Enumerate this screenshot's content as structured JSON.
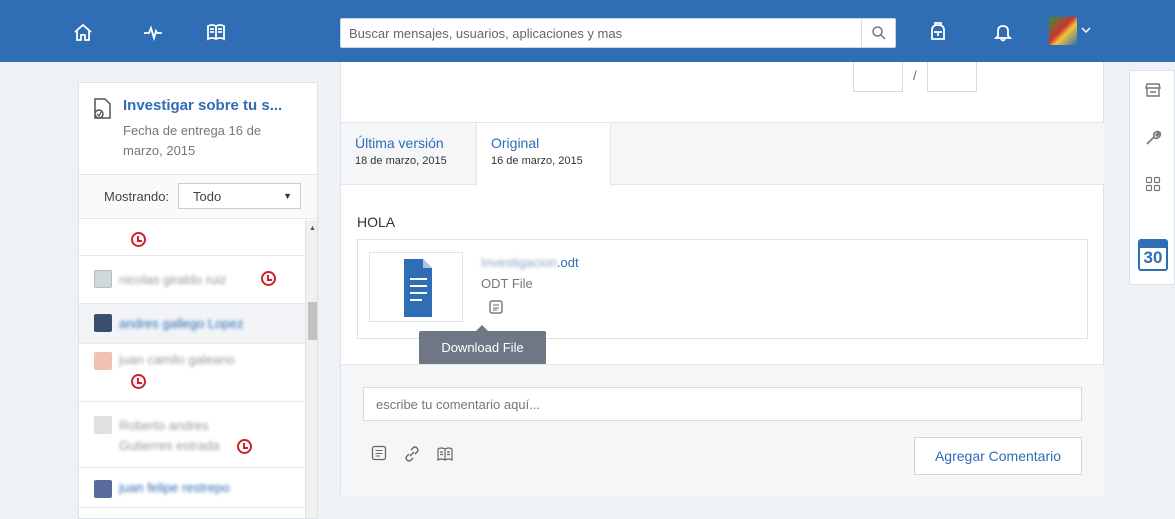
{
  "topbar": {
    "search_placeholder": "Buscar mensajes, usuarios, aplicaciones y mas",
    "icons": [
      "home-icon",
      "activity-icon",
      "book-icon",
      "search-icon",
      "backpack-icon",
      "bell-icon",
      "avatar",
      "chevron-down-icon"
    ]
  },
  "assignment": {
    "title": "Investigar sobre tu s...",
    "due": "Fecha de entrega 16 de marzo, 2015"
  },
  "filter": {
    "label": "Mostrando:",
    "selected": "Todo"
  },
  "students": [
    {
      "name": "",
      "late": true
    },
    {
      "name": "nicolas giraldo ruiz",
      "late": true
    },
    {
      "name": "andres gallego Lopez",
      "late": false
    },
    {
      "name": "juan camilo galeano",
      "late": true
    },
    {
      "name": "Roberto andres Gutierres estrada",
      "late": true
    },
    {
      "name": "juan felipe restrepo",
      "late": false
    }
  ],
  "tabs": [
    {
      "label": "Última versión",
      "date": "18 de marzo, 2015"
    },
    {
      "label": "Original",
      "date": "16 de marzo, 2015"
    }
  ],
  "submission": {
    "text": "HOLA",
    "file_name_blurred": "Investigacion",
    "file_ext": ".odt",
    "file_type": "ODT File",
    "tooltip": "Download File"
  },
  "comment": {
    "placeholder": "escribe tu comentario aquí...",
    "button": "Agregar Comentario"
  },
  "sidebar_right": {
    "calendar_day": "30"
  },
  "colors": {
    "brand": "#2f6db5",
    "late": "#d0202b",
    "tooltip": "#6f7784"
  }
}
